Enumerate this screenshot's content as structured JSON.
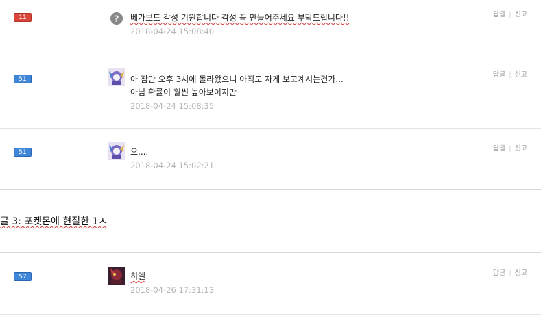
{
  "comments": [
    {
      "badge": "11",
      "badge_color": "#d9473b",
      "avatar": "question-avatar",
      "lines": [
        "베가보드 각성 기원합니다 각성 꼭 만들어주세요 부탁드립니다!!"
      ],
      "time": "2018-04-24 15:08:40",
      "reply": "답글",
      "report": "신고"
    },
    {
      "badge": "51",
      "badge_color": "#3f86d9",
      "avatar": "character-avatar",
      "lines": [
        "아 잠만 오후 3시에 돌라왔으니 아직도 자게 보고계시는건가...",
        "아님 확률이 훨씬 높아보이지만"
      ],
      "time": "2018-04-24 15:08:35",
      "reply": "답글",
      "report": "신고"
    },
    {
      "badge": "51",
      "badge_color": "#3f86d9",
      "avatar": "character-avatar",
      "lines": [
        "오...."
      ],
      "time": "2018-04-24 15:02:21",
      "reply": "답글",
      "report": "신고"
    },
    {
      "badge": "57",
      "badge_color": "#3f86d9",
      "avatar": "dark-character-avatar",
      "lines": [
        "히엘"
      ],
      "time": "2018-04-26 17:31:13",
      "reply": "답글",
      "report": "신고"
    }
  ],
  "section": {
    "title": "글 3: 포켓몬에 현질한 1ㅅ"
  }
}
